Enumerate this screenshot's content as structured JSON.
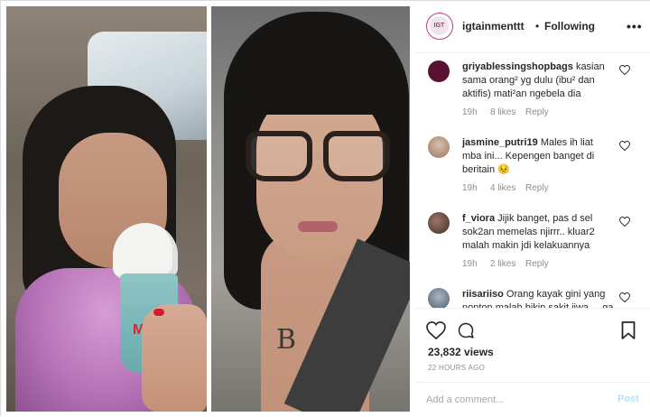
{
  "header": {
    "avatar_text": "IGT",
    "username": "igtainmenttt",
    "separator": "•",
    "follow_status": "Following",
    "more_icon": "more-horizontal-icon"
  },
  "media": {
    "right_photo_pendant": "B"
  },
  "comments": [
    {
      "username": "griyablessingshopbags",
      "text": "kasian sama orang² yg dulu (ibu² dan aktifis) mati²an ngebela dia",
      "time": "19h",
      "likes": "8 likes",
      "reply": "Reply",
      "avatar_color": "#5a1233"
    },
    {
      "username": "jasmine_putri19",
      "text": "Males ih liat mba ini... Kepengen banget di beritain 😣",
      "time": "19h",
      "likes": "4 likes",
      "reply": "Reply",
      "avatar_color": "#b89a84"
    },
    {
      "username": "f_viora",
      "text": "Jijik banget, pas d sel sok2an memelas njirrr.. kluar2 malah makin jdi kelakuannya",
      "time": "19h",
      "likes": "2 likes",
      "reply": "Reply",
      "avatar_color": "#6b4a3e"
    },
    {
      "username": "riisariiso",
      "text": "Orang kayak gini yang nonton malah bikin sakit jiwa ... ga",
      "time": "",
      "likes": "",
      "reply": "",
      "avatar_color": "#7d8a99"
    }
  ],
  "actions": {
    "views": "23,832 views",
    "time_ago": "22 HOURS AGO"
  },
  "add_comment": {
    "placeholder": "Add a comment...",
    "post_label": "Post"
  },
  "colors": {
    "avatar_ring": "#c1378a",
    "post_disabled": "#b2dffc",
    "secondary_text": "#8e8e8e"
  }
}
